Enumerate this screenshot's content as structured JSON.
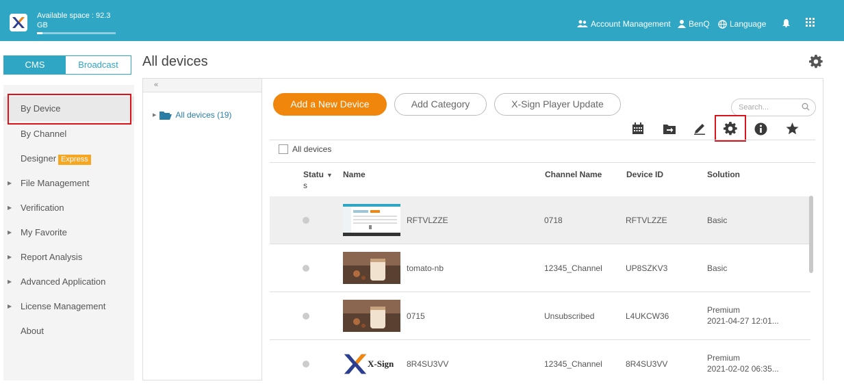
{
  "header": {
    "available_space": "Available space : 92.3 GB",
    "space_used_fraction": 0.07,
    "account_management": "Account Management",
    "user": "BenQ",
    "language": "Language"
  },
  "tabs": {
    "cms": "CMS",
    "broadcast": "Broadcast"
  },
  "page": {
    "title": "All devices"
  },
  "sidebar": {
    "items": [
      {
        "label": "By Device",
        "caret": false
      },
      {
        "label": "By Channel",
        "caret": false
      },
      {
        "label": "Designer",
        "badge": "Express",
        "caret": false
      },
      {
        "label": "File Management",
        "caret": true
      },
      {
        "label": "Verification",
        "caret": true
      },
      {
        "label": "My Favorite",
        "caret": true
      },
      {
        "label": "Report Analysis",
        "caret": true
      },
      {
        "label": "Advanced Application",
        "caret": true
      },
      {
        "label": "License Management",
        "caret": true
      },
      {
        "label": "About",
        "caret": false
      }
    ]
  },
  "tree": {
    "collapse": "«",
    "root": "All devices (19)"
  },
  "toolbar": {
    "add_device": "Add a New Device",
    "add_category": "Add Category",
    "player_update": "X-Sign Player Update",
    "search_placeholder": "Search...",
    "icons": [
      "calendar-icon",
      "move-folder-icon",
      "edit-icon",
      "settings-icon",
      "info-icon",
      "star-icon"
    ]
  },
  "table": {
    "select_all": "All devices",
    "columns": {
      "status_line1": "Statu",
      "status_line2": "s",
      "name": "Name",
      "channel": "Channel Name",
      "device_id": "Device ID",
      "solution": "Solution"
    },
    "rows": [
      {
        "name": "RFTVLZZE",
        "channel": "0718",
        "device_id": "RFTVLZZE",
        "solution": "Basic",
        "solution_date": "",
        "thumb": "screenshot"
      },
      {
        "name": "tomato-nb",
        "channel": "12345_Channel",
        "device_id": "UP8SZKV3",
        "solution": "Basic",
        "solution_date": "",
        "thumb": "drink"
      },
      {
        "name": "0715",
        "channel": "Unsubscribed",
        "device_id": "L4UKCW36",
        "solution": "Premium",
        "solution_date": "2021-04-27 12:01...",
        "thumb": "drink"
      },
      {
        "name": "8R4SU3VV",
        "channel": "12345_Channel",
        "device_id": "8R4SU3VV",
        "solution": "Premium",
        "solution_date": "2021-02-02 06:35...",
        "thumb": "xsign",
        "thumb_text": "X-Sign"
      }
    ]
  },
  "colors": {
    "brand": "#2ea6c4",
    "primary_button": "#f0870c",
    "highlight": "#d8131a",
    "badge": "#f5a623"
  }
}
